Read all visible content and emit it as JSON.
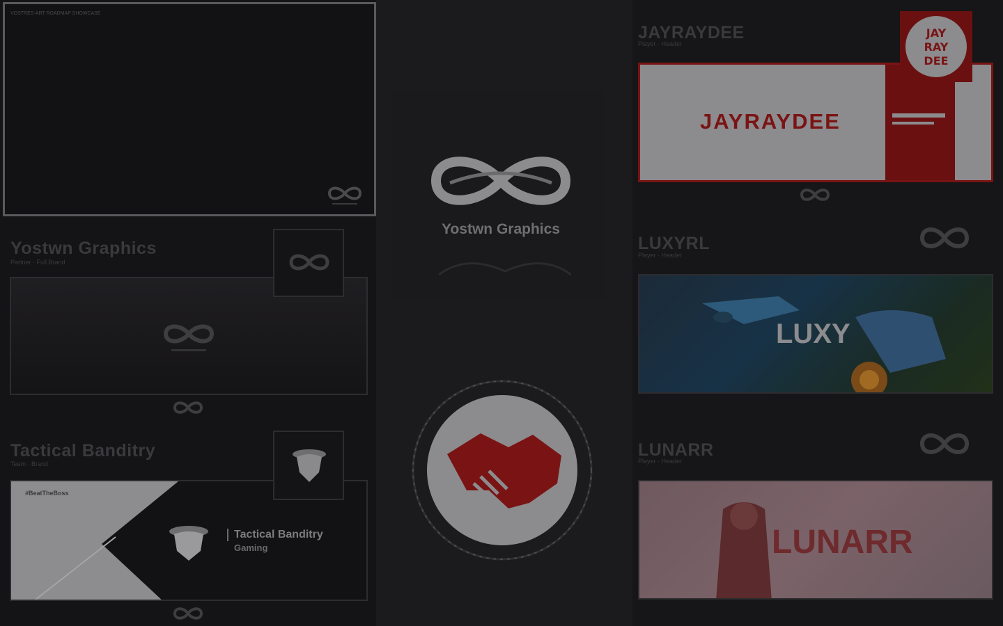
{
  "top_left_caption": "VOSTRES-ART ROADMAP SHOWCASE",
  "cards": [
    {
      "title": "Yostwn Graphics",
      "subtitle": "Partner · Full Brand"
    },
    {
      "title": "Tactical Banditry",
      "subtitle": "Team · Brand",
      "banner_tag": "#BeatTheBoss",
      "banner_name": "Tactical Banditry",
      "banner_sub": "Gaming"
    },
    {
      "title": "JAYRAYDEE",
      "subtitle": "Player · Header",
      "banner_name": "JAYRAYDEE",
      "badge_text": "JAY\nRAY\nDEE"
    },
    {
      "title": "LUXYRL",
      "subtitle": "Player · Header",
      "banner_name": "LUXY"
    },
    {
      "title": "LUNARR",
      "subtitle": "Player · Header",
      "banner_name": "LUNARR"
    }
  ],
  "center_logo_text": "Yostwn Graphics",
  "colors": {
    "red": "#7a1414",
    "dim_red": "#8a1818",
    "light": "#c9c9c9"
  }
}
